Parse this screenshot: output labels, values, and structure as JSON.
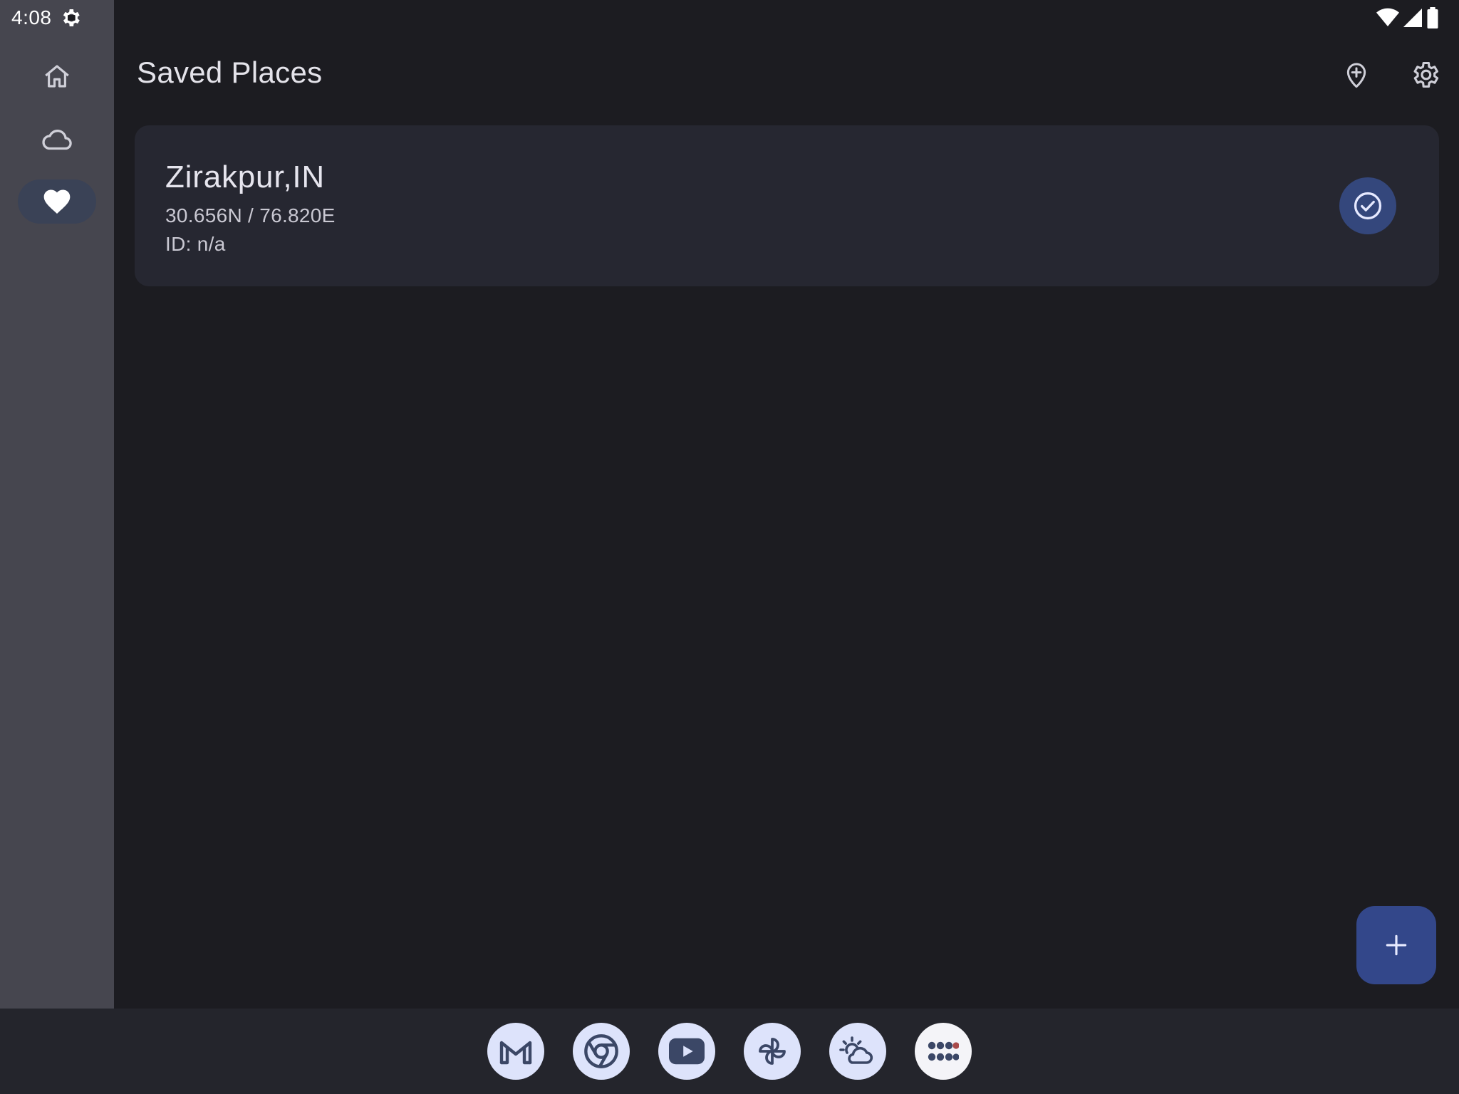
{
  "status_bar": {
    "time": "4:08",
    "left_icons": [
      "settings-gear-icon"
    ],
    "right_icons": [
      "wifi-icon",
      "cellular-signal-icon",
      "battery-icon"
    ]
  },
  "nav_rail": {
    "items": [
      {
        "icon": "home-icon",
        "selected": false
      },
      {
        "icon": "cloud-icon",
        "selected": false
      },
      {
        "icon": "heart-icon",
        "selected": true
      }
    ]
  },
  "app_bar": {
    "title": "Saved Places",
    "actions": [
      "add-location-icon",
      "settings-icon"
    ]
  },
  "places": [
    {
      "name": "Zirakpur,IN",
      "coords": "30.656N / 76.820E",
      "id_text": "ID: n/a",
      "selected": true
    }
  ],
  "fab": {
    "icon": "plus-icon"
  },
  "taskbar": {
    "apps": [
      "gmail-icon",
      "chrome-icon",
      "youtube-icon",
      "pinwheel-icon",
      "weather-icon",
      "app-drawer-icon"
    ]
  },
  "colors": {
    "background": "#1c1c21",
    "nav_rail": "#46464f",
    "card": "#262731",
    "accent": "#34477c",
    "fab": "#33478a",
    "taskbar": "#24252c",
    "dock_icon_bg": "#dde3fb"
  }
}
